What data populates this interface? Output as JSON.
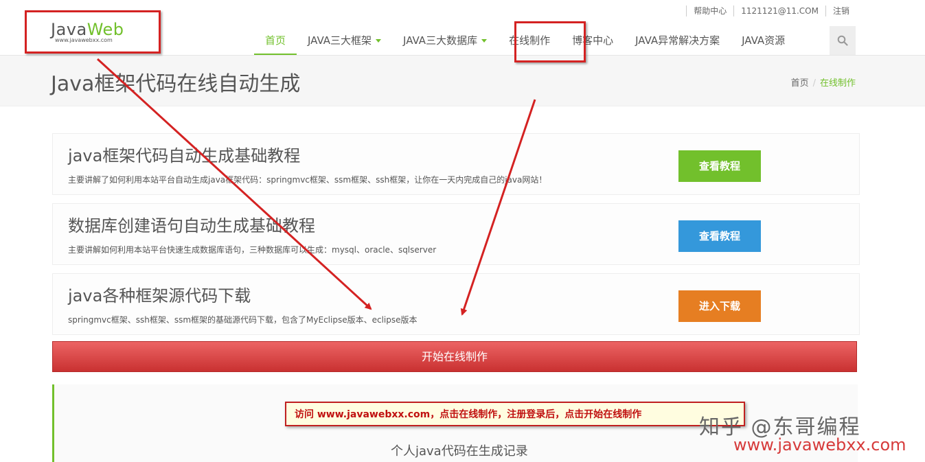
{
  "header": {
    "top_links": [
      "帮助中心",
      "1121121@11.COM",
      "注销"
    ],
    "logo": {
      "brand_a": "Java",
      "brand_b": "Web",
      "sub": "www.javawebxx.com"
    },
    "nav": [
      {
        "label": "首页",
        "active": true,
        "dropdown": false
      },
      {
        "label": "JAVA三大框架",
        "active": false,
        "dropdown": true
      },
      {
        "label": "JAVA三大数据库",
        "active": false,
        "dropdown": true
      },
      {
        "label": "在线制作",
        "active": false,
        "dropdown": false
      },
      {
        "label": "博客中心",
        "active": false,
        "dropdown": false
      },
      {
        "label": "JAVA异常解决方案",
        "active": false,
        "dropdown": false
      },
      {
        "label": "JAVA资源",
        "active": false,
        "dropdown": false
      }
    ],
    "search_icon": "search-icon"
  },
  "page": {
    "title": "Java框架代码在线自动生成",
    "breadcrumb": {
      "home": "首页",
      "separator": "/",
      "current": "在线制作"
    }
  },
  "cards": [
    {
      "title": "java框架代码自动生成基础教程",
      "desc": "主要讲解了如何利用本站平台自动生成java框架代码：springmvc框架、ssm框架、ssh框架，让你在一天内完成自己的java网站！",
      "button": "查看教程",
      "color": "#72c02c"
    },
    {
      "title": "数据库创建语句自动生成基础教程",
      "desc": "主要讲解如何利用本站平台快速生成数据库语句，三种数据库可以生成：mysql、oracle、sqlserver",
      "button": "查看教程",
      "color": "#3498db"
    },
    {
      "title": "java各种框架源代码下载",
      "desc": "springmvc框架、ssh框架、ssm框架的基础源代码下载，包含了MyEclipse版本、eclipse版本",
      "button": "进入下载",
      "color": "#e67e22"
    }
  ],
  "start_button": "开始在线制作",
  "bottom": {
    "records_label": "个人java代码在生成记录"
  },
  "annotation": {
    "notice": "访问 www.javawebxx.com，点击在线制作，注册登录后，点击开始在线制作"
  },
  "watermark": {
    "text": "知乎 @东哥编程",
    "url": "www.javawebxx.com"
  },
  "colors": {
    "accent": "#72c02c",
    "annotation_red": "#d42222"
  }
}
